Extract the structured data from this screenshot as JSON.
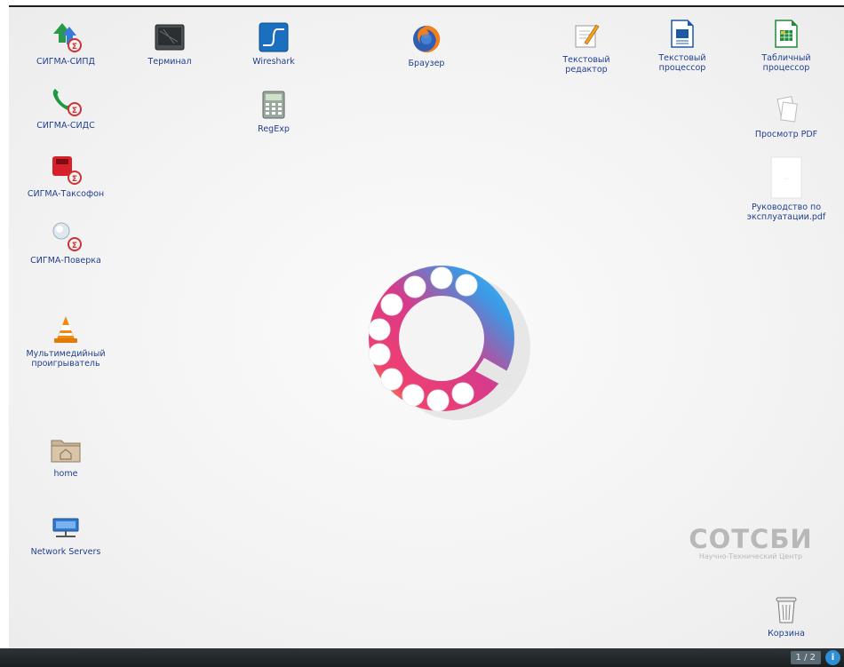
{
  "desktop": {
    "icons": [
      {
        "label": "СИГМА-СИПД",
        "icon": "sigma-sipd-icon"
      },
      {
        "label": "Терминал",
        "icon": "terminal-icon"
      },
      {
        "label": "Wireshark",
        "icon": "wireshark-icon"
      },
      {
        "label": "Браузер",
        "icon": "firefox-icon"
      },
      {
        "label": "Текстовый\nредактор",
        "icon": "text-editor-icon"
      },
      {
        "label": "Текстовый\nпроцессор",
        "icon": "word-processor-icon"
      },
      {
        "label": "Табличный\nпроцессор",
        "icon": "spreadsheet-icon"
      },
      {
        "label": "СИГМА-СИДС",
        "icon": "phone-icon"
      },
      {
        "label": "RegExp",
        "icon": "calculator-icon"
      },
      {
        "label": "Просмотр PDF",
        "icon": "pdf-viewer-icon"
      },
      {
        "label": "СИГМА-Таксофон",
        "icon": "payphone-icon"
      },
      {
        "label": "Руководство по\nэксплуатации.pdf",
        "icon": "pdf-file-icon"
      },
      {
        "label": "СИГМА-Поверка",
        "icon": "verification-icon"
      },
      {
        "label": "Мультимедийный\nпроигрыватель",
        "icon": "vlc-icon"
      },
      {
        "label": "home",
        "icon": "home-folder-icon"
      },
      {
        "label": "Network Servers",
        "icon": "network-servers-icon"
      },
      {
        "label": "Корзина",
        "icon": "trash-icon"
      }
    ]
  },
  "brand": {
    "name": "СОТСБИ",
    "subtitle": "Научно-Технический Центр"
  },
  "taskbar": {
    "pager": "1 / 2",
    "tray_icon": "info-icon"
  },
  "colors": {
    "label_text": "#1c3b8c",
    "taskbar": "#1f2528",
    "brand_gray": "#b8b8b8"
  }
}
